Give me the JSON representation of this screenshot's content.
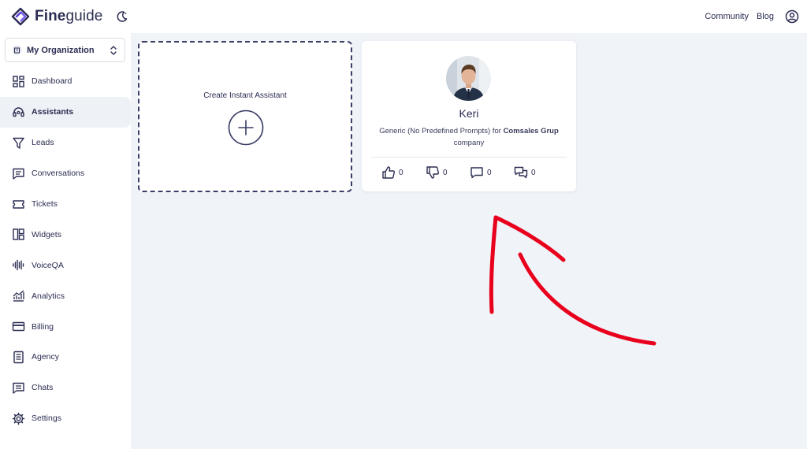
{
  "brand": {
    "name_bold": "Fine",
    "name_rest": "guide"
  },
  "header": {
    "links": [
      "Community",
      "Blog"
    ],
    "user_icon": "user-circle-icon",
    "theme_icon": "moon-icon"
  },
  "sidebar": {
    "org": {
      "label": "My Organization",
      "icon": "building-icon"
    },
    "items": [
      {
        "label": "Dashboard",
        "icon": "dashboard-icon",
        "active": false
      },
      {
        "label": "Assistants",
        "icon": "headset-icon",
        "active": true
      },
      {
        "label": "Leads",
        "icon": "filter-icon",
        "active": false
      },
      {
        "label": "Conversations",
        "icon": "message-icon",
        "active": false
      },
      {
        "label": "Tickets",
        "icon": "ticket-icon",
        "active": false
      },
      {
        "label": "Widgets",
        "icon": "layout-icon",
        "active": false
      },
      {
        "label": "VoiceQA",
        "icon": "waveform-icon",
        "active": false
      },
      {
        "label": "Analytics",
        "icon": "chart-icon",
        "active": false
      },
      {
        "label": "Billing",
        "icon": "credit-card-icon",
        "active": false
      },
      {
        "label": "Agency",
        "icon": "document-icon",
        "active": false
      },
      {
        "label": "Chats",
        "icon": "chat-icon",
        "active": false
      },
      {
        "label": "Settings",
        "icon": "gear-icon",
        "active": false
      }
    ]
  },
  "main": {
    "create_card": {
      "label": "Create Instant Assistant",
      "icon": "plus-circle-icon"
    },
    "assistant_card": {
      "name": "Keri",
      "desc_prefix": "Generic (No Predefined Prompts) for ",
      "company": "Comsales Grup",
      "desc_suffix": " company",
      "stats": [
        {
          "icon": "thumbs-up-icon",
          "value": "0"
        },
        {
          "icon": "thumbs-down-icon",
          "value": "0"
        },
        {
          "icon": "comment-icon",
          "value": "0"
        },
        {
          "icon": "comments-icon",
          "value": "0"
        }
      ]
    },
    "annotation": {
      "icon": "red-arrow-annotation",
      "color": "#e8001c"
    }
  },
  "colors": {
    "text": "#2b2d52",
    "accent": "#5b3fd6",
    "background": "#f0f3f8",
    "active_nav": "#eef1f6"
  }
}
